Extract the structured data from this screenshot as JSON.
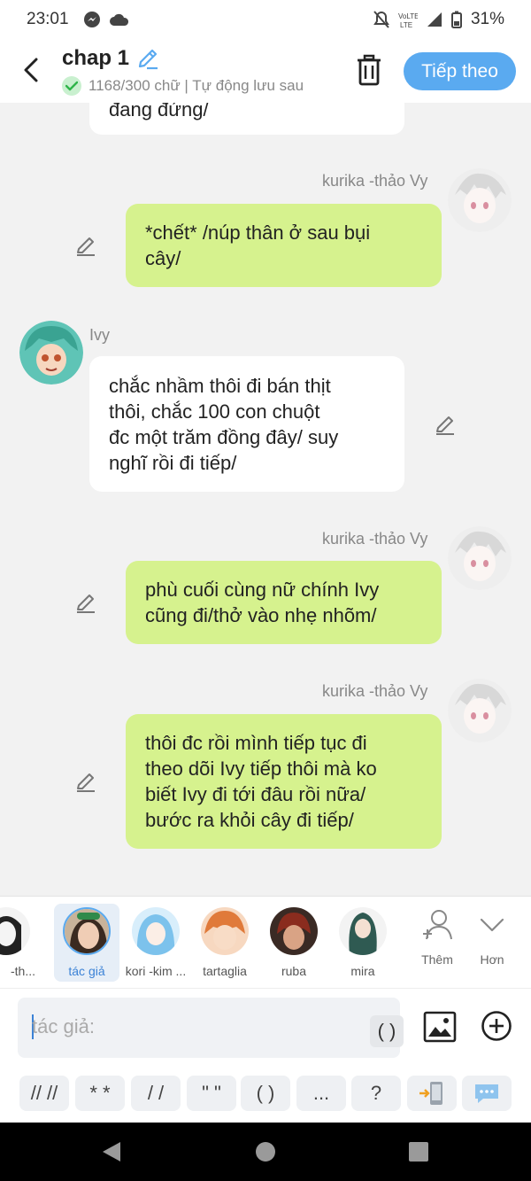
{
  "status_bar": {
    "time": "23:01",
    "battery": "31%"
  },
  "header": {
    "title": "chap 1",
    "subtitle": "1168/300 chữ | Tự động lưu sau",
    "next_label": "Tiếp theo"
  },
  "chat": {
    "top_fragment": "đang đứng/",
    "messages": [
      {
        "speaker": "kurika -thảo Vy",
        "lines": [
          "*chết* /núp thân ở sau bụi",
          "cây/"
        ]
      },
      {
        "speaker": "Ivy",
        "lines": [
          "chắc nhầm thôi đi bán thịt",
          "thôi, chắc 100 con chuột",
          "đc một trăm đồng đây/ suy",
          "nghĩ rồi đi tiếp/"
        ]
      },
      {
        "speaker": "kurika -thảo Vy",
        "lines": [
          "phù cuối cùng nữ chính Ivy",
          "cũng đi/thở vào nhẹ nhõm/"
        ]
      },
      {
        "speaker": "kurika -thảo Vy",
        "lines": [
          "thôi đc rồi mình tiếp tục đi",
          "theo dõi Ivy tiếp thôi mà ko",
          "biết Ivy đi tới đâu rồi nữa/",
          "bước ra khỏi cây đi tiếp/"
        ]
      }
    ]
  },
  "picker": {
    "characters": [
      {
        "label": "-th..."
      },
      {
        "label": "tác giả"
      },
      {
        "label": "kori -kim ..."
      },
      {
        "label": "tartaglia"
      },
      {
        "label": "ruba"
      },
      {
        "label": "mira"
      }
    ],
    "add_label": "Thêm",
    "more_label": "Hơn"
  },
  "input": {
    "placeholder": "tác giả:",
    "paren_label": "( )"
  },
  "format_buttons": [
    "// //",
    "* *",
    "/ /",
    "\" \"",
    "( )",
    "..."
  ],
  "format_question": "?",
  "colors": {
    "accent": "#5aaaf0",
    "green_bubble": "#d6f28e"
  }
}
